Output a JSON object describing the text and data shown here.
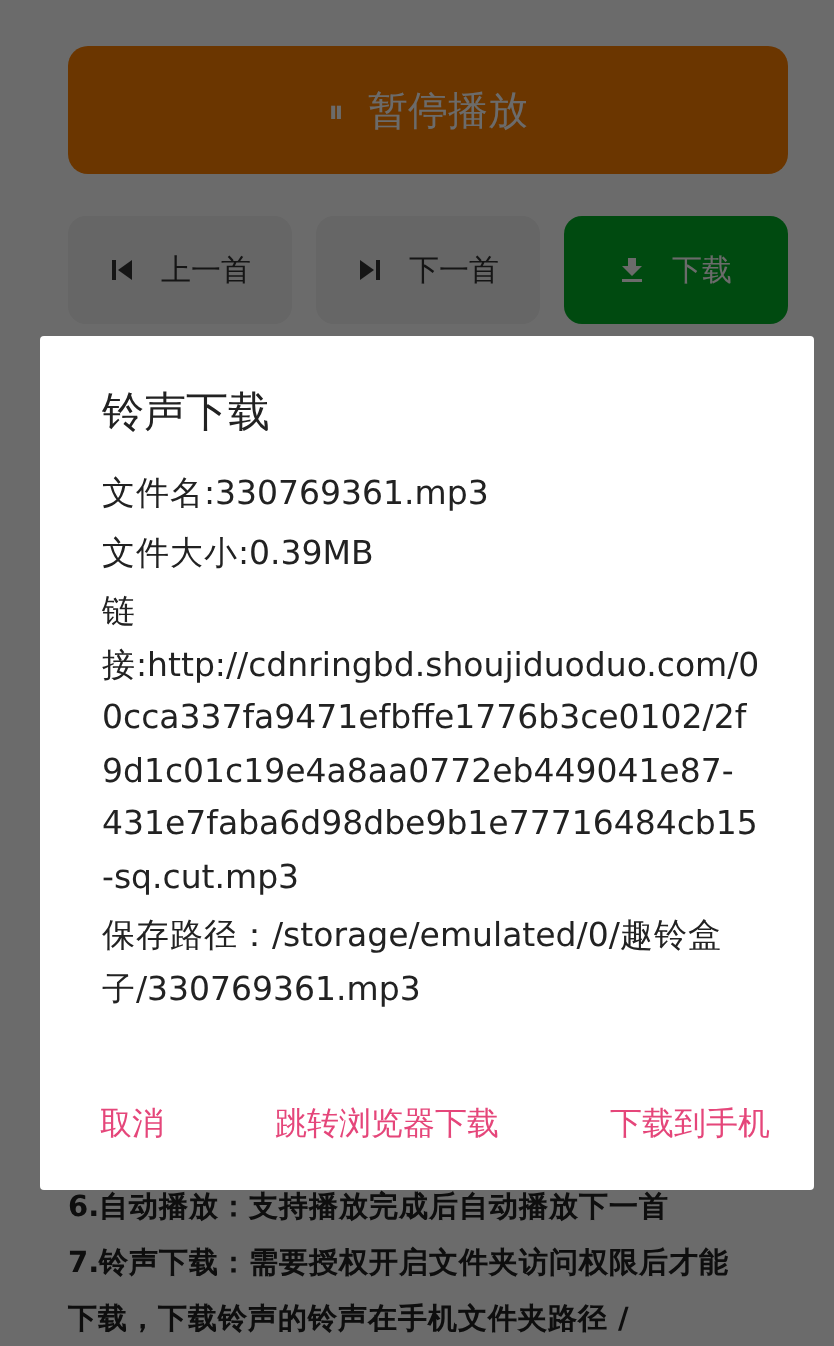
{
  "player": {
    "pause_button": {
      "icon": "⏸",
      "label": "暂停播放"
    },
    "controls": [
      {
        "kind": "prev",
        "label": "上一首"
      },
      {
        "kind": "next",
        "label": "下一首"
      },
      {
        "kind": "download",
        "label": "下载"
      }
    ]
  },
  "features": [
    "6.自动播放：支持播放完成后自动播放下一首",
    "7.铃声下载：需要授权开启文件夹访问权限后才能下载，下载铃声的铃声在手机文件夹路径 /"
  ],
  "dialog": {
    "title": "铃声下载",
    "lines": [
      "文件名:330769361.mp3",
      "文件大小:0.39MB",
      "链接:http://cdnringbd.shoujiduoduo.com/00cca337fa9471efbffe1776b3ce0102/2f9d1c01c19e4a8aa0772eb449041e87-431e7faba6d98dbe9b1e77716484cb15-sq.cut.mp3",
      "保存路径：/storage/emulated/0/趣铃盒子/330769361.mp3"
    ],
    "buttons": [
      "取消",
      "跳转浏览器下载",
      "下载到手机"
    ]
  }
}
